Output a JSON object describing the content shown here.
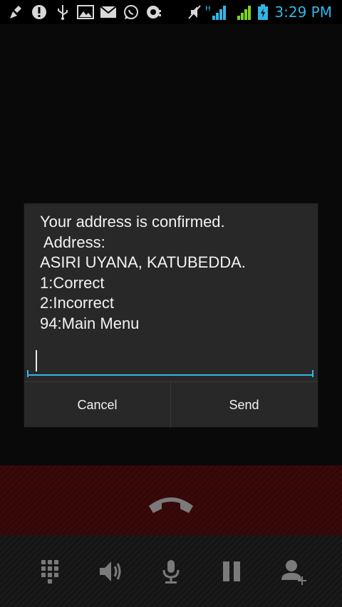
{
  "status_bar": {
    "time": "3:29 PM",
    "left_icons": [
      "broom-icon",
      "alert-icon",
      "usb-icon",
      "image-icon",
      "mail-icon",
      "whatsapp-icon",
      "chat-icon"
    ],
    "right_icons": [
      "muted-icon",
      "signal-h-icon",
      "signal-icon",
      "battery-charging-icon"
    ],
    "accent": "#33b5e5"
  },
  "dialog": {
    "message": "Your address is confirmed.\n Address:\nASIRI UYANA, KATUBEDDA.\n1:Correct\n2:Incorrect\n94:Main Menu",
    "input_value": "",
    "cancel_label": "Cancel",
    "send_label": "Send"
  },
  "call_controls": [
    "dialpad-icon",
    "speaker-icon",
    "mute-mic-icon",
    "hold-icon",
    "add-call-icon"
  ],
  "colors": {
    "end_call_band": "#3a0a0a",
    "dialog_bg": "#282828"
  }
}
